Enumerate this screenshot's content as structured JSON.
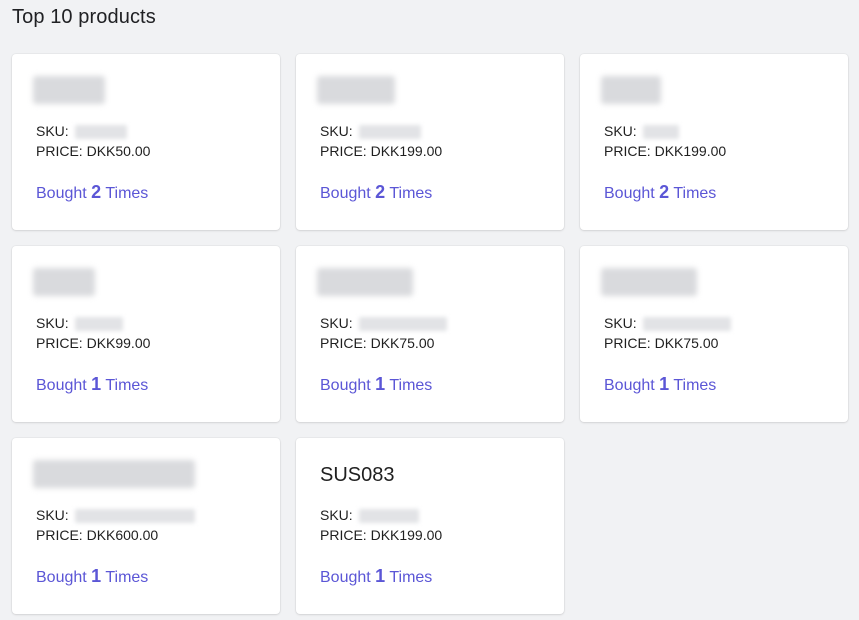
{
  "header": {
    "title": "Top 10 products"
  },
  "labels": {
    "sku": "SKU:",
    "price": "PRICE:",
    "bought_prefix": "Bought",
    "bought_suffix": "Times"
  },
  "colors": {
    "accent": "#5b56d6",
    "background": "#f1f2f4",
    "card": "#ffffff"
  },
  "products": [
    {
      "name": "",
      "price": "DKK50.00",
      "bought": "2"
    },
    {
      "name": "",
      "price": "DKK199.00",
      "bought": "2"
    },
    {
      "name": "",
      "price": "DKK199.00",
      "bought": "2"
    },
    {
      "name": "",
      "price": "DKK99.00",
      "bought": "1"
    },
    {
      "name": "",
      "price": "DKK75.00",
      "bought": "1"
    },
    {
      "name": "",
      "price": "DKK75.00",
      "bought": "1"
    },
    {
      "name": "",
      "price": "DKK600.00",
      "bought": "1"
    },
    {
      "name": "SUS083",
      "price": "DKK199.00",
      "bought": "1"
    }
  ]
}
